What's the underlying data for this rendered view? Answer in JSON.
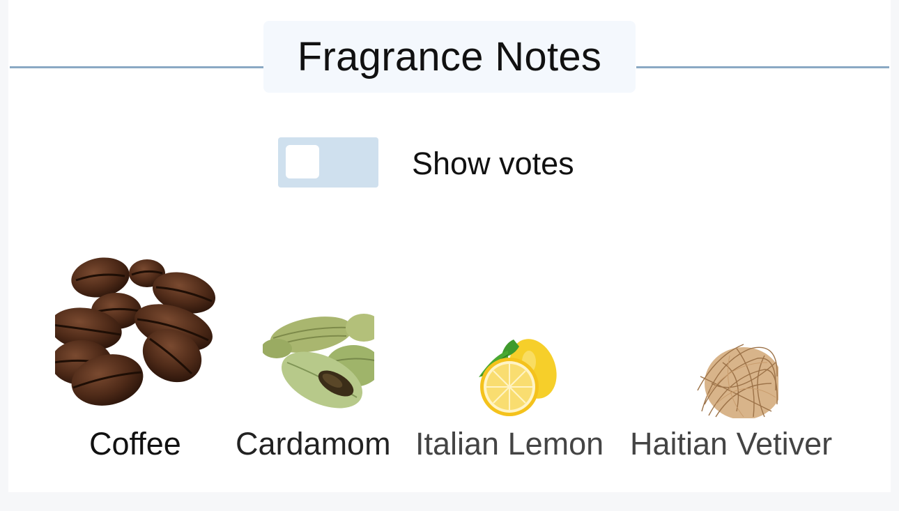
{
  "section": {
    "title": "Fragrance Notes"
  },
  "votes_toggle": {
    "label": "Show votes",
    "on": false
  },
  "notes": [
    {
      "name": "Coffee",
      "icon": "coffee-beans-icon",
      "color": "#111111"
    },
    {
      "name": "Cardamom",
      "icon": "cardamom-pods-icon",
      "color": "#222222"
    },
    {
      "name": "Italian Lemon",
      "icon": "lemon-icon",
      "color": "#444444"
    },
    {
      "name": "Haitian Vetiver",
      "icon": "vetiver-roots-icon",
      "color": "#444444"
    }
  ]
}
